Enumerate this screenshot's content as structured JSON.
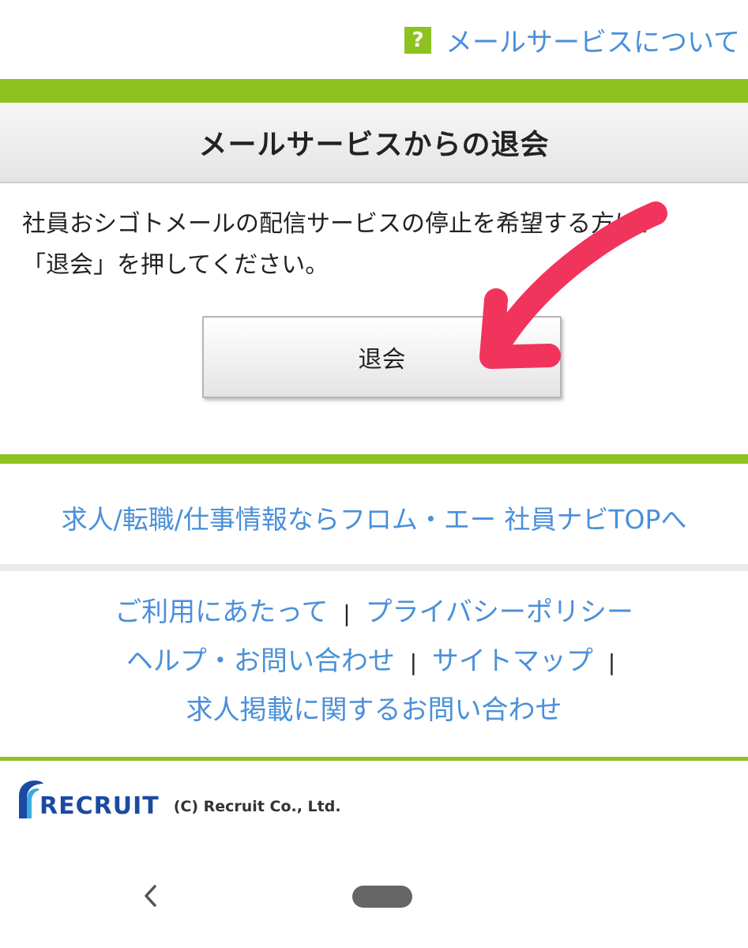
{
  "header": {
    "help_icon": "question-mark-icon",
    "help_icon_glyph": "?",
    "help_link": "メールサービスについて"
  },
  "title": "メールサービスからの退会",
  "message": {
    "line1": "社員おシゴトメールの配信サービスの停止を希望する方は、",
    "line2": "「退会」を押してください。"
  },
  "withdraw_button": "退会",
  "top_link": "求人/転職/仕事情報ならフロム・エー 社員ナビTOPへ",
  "footer": {
    "link_terms": "ご利用にあたって",
    "link_privacy": "プライバシーポリシー",
    "link_help": "ヘルプ・お問い合わせ",
    "link_sitemap": "サイトマップ",
    "link_listing": "求人掲載に関するお問い合わせ",
    "separator": "|"
  },
  "brand": {
    "logo_text": "RECRUIT",
    "copyright": "(C) Recruit Co., Ltd."
  },
  "colors": {
    "accent_green": "#8dc21f",
    "link_blue": "#4a90d9",
    "arrow_red": "#f0345c",
    "brand_blue": "#1a4aa3"
  }
}
